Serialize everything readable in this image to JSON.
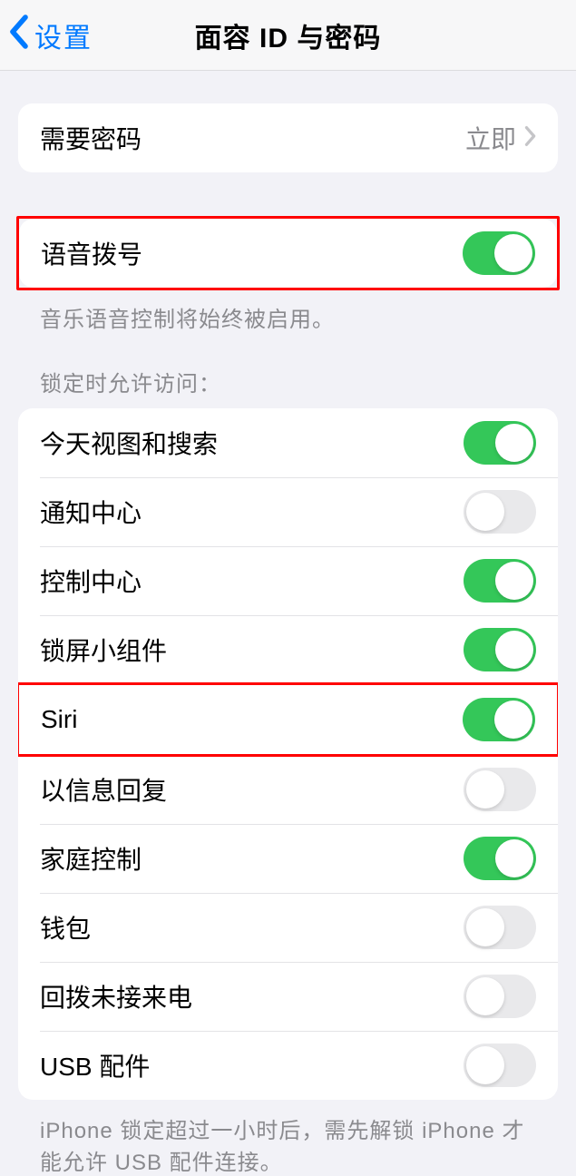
{
  "nav": {
    "back": "设置",
    "title": "面容 ID 与密码"
  },
  "require_passcode": {
    "label": "需要密码",
    "value": "立即"
  },
  "voice_dial": {
    "label": "语音拨号",
    "footer": "音乐语音控制将始终被启用。"
  },
  "lock_access": {
    "header": "锁定时允许访问：",
    "items": [
      {
        "label": "今天视图和搜索",
        "on": true
      },
      {
        "label": "通知中心",
        "on": false
      },
      {
        "label": "控制中心",
        "on": true
      },
      {
        "label": "锁屏小组件",
        "on": true
      },
      {
        "label": "Siri",
        "on": true
      },
      {
        "label": "以信息回复",
        "on": false
      },
      {
        "label": "家庭控制",
        "on": true
      },
      {
        "label": "钱包",
        "on": false
      },
      {
        "label": "回拨未接来电",
        "on": false
      },
      {
        "label": "USB 配件",
        "on": false
      }
    ],
    "footer": "iPhone 锁定超过一小时后，需先解锁 iPhone 才能允许 USB 配件连接。"
  }
}
